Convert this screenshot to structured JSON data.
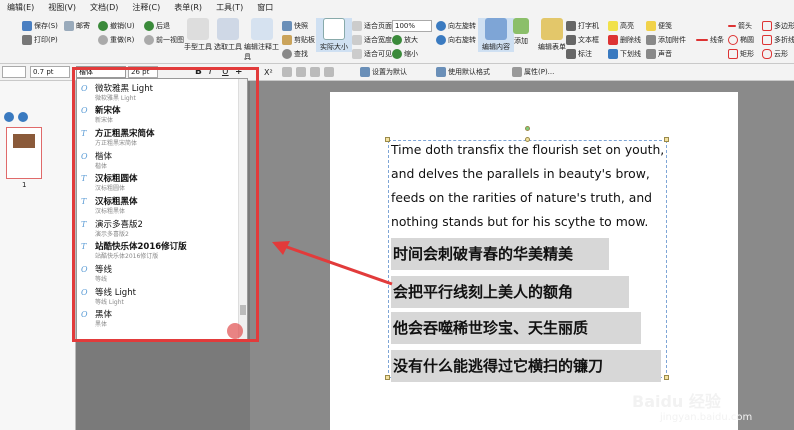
{
  "menu": [
    "编辑(E)",
    "视图(V)",
    "文档(D)",
    "注释(C)",
    "表单(R)",
    "工具(T)",
    "窗口"
  ],
  "ribbon": {
    "save": "保存(S)",
    "print": "打印(P)",
    "email": "邮寄",
    "undo": "撤销(U)",
    "redo": "重做(R)",
    "back": "后退",
    "forward": "前一视图",
    "hand": "手型工具",
    "select": "选取工具",
    "edit_comment": "编辑注释工具",
    "snapshot": "快照",
    "clipboard": "剪贴板",
    "find": "查找",
    "zoom": "实际大小",
    "fit_page": "适合页面",
    "fit_width": "适合宽度",
    "fit_visible": "适合可见",
    "zoom_value": "100%",
    "zoom_in": "放大",
    "zoom_out": "缩小",
    "rotate_left": "向左旋转",
    "rotate_right": "向右旋转",
    "edit_content": "编辑内容",
    "add": "添加",
    "edit_form": "编辑表单",
    "typewriter": "打字机",
    "text_box": "文本框",
    "callout": "标注",
    "highlight": "高亮",
    "strikeout": "删除线",
    "underline": "下划线",
    "note": "便笺",
    "add_attach": "添加附件",
    "sound": "声音",
    "line": "线条",
    "arrow": "箭头",
    "rect": "矩形",
    "oval": "椭圆",
    "polygon": "多边形",
    "cloud": "云形",
    "polyline": "多折线",
    "pencil": "铅笔"
  },
  "format": {
    "font_value": "楷体",
    "stroke_width": "0.7 pt",
    "size": "26 pt",
    "bold": "B",
    "italic": "I",
    "underline": "U",
    "strike": "T",
    "sup": "X²",
    "set_default": "设置为默认",
    "use_default": "使用默认格式",
    "properties": "属性(P)..."
  },
  "sidebar": {
    "page_number": "1"
  },
  "fonts": [
    {
      "name": "微软雅黑 Light",
      "sub": "微软雅黑 Light"
    },
    {
      "name": "新宋体",
      "sub": "新宋体"
    },
    {
      "name": "方正粗黑宋简体",
      "sub": "方正粗黑宋简体"
    },
    {
      "name": "楷体",
      "sub": "楷体"
    },
    {
      "name": "汉标粗圆体",
      "sub": "汉标粗圆体"
    },
    {
      "name": "汉标粗黑体",
      "sub": "汉标粗黑体"
    },
    {
      "name": "演示多喜版2",
      "sub": "演示多喜版2"
    },
    {
      "name": "站酷快乐体2016修订版",
      "sub": "站酷快乐体2016修订版"
    },
    {
      "name": "等线",
      "sub": "等线"
    },
    {
      "name": "等线 Light",
      "sub": "等线 Light"
    },
    {
      "name": "黑体",
      "sub": "黑体"
    }
  ],
  "document": {
    "en_lines": [
      "Time doth transfix the flourish set on youth,",
      "and delves the parallels in beauty's brow,",
      "feeds on the rarities of nature's truth, and",
      "nothing stands but for his scythe to mow."
    ],
    "cn_lines": [
      "时间会刺破青春的华美精美",
      "会把平行线刻上美人的额角",
      "他会吞噬稀世珍宝、天生丽质",
      "没有什么能逃得过它横扫的镰刀"
    ]
  },
  "watermark": {
    "brand": "Baidu 经验",
    "url": "jingyan.baidu.com"
  },
  "colors": {
    "annotation_red": "#e23b3b",
    "text_highlight": "#d7d7d7",
    "selection_blue": "#7ea5d6"
  }
}
